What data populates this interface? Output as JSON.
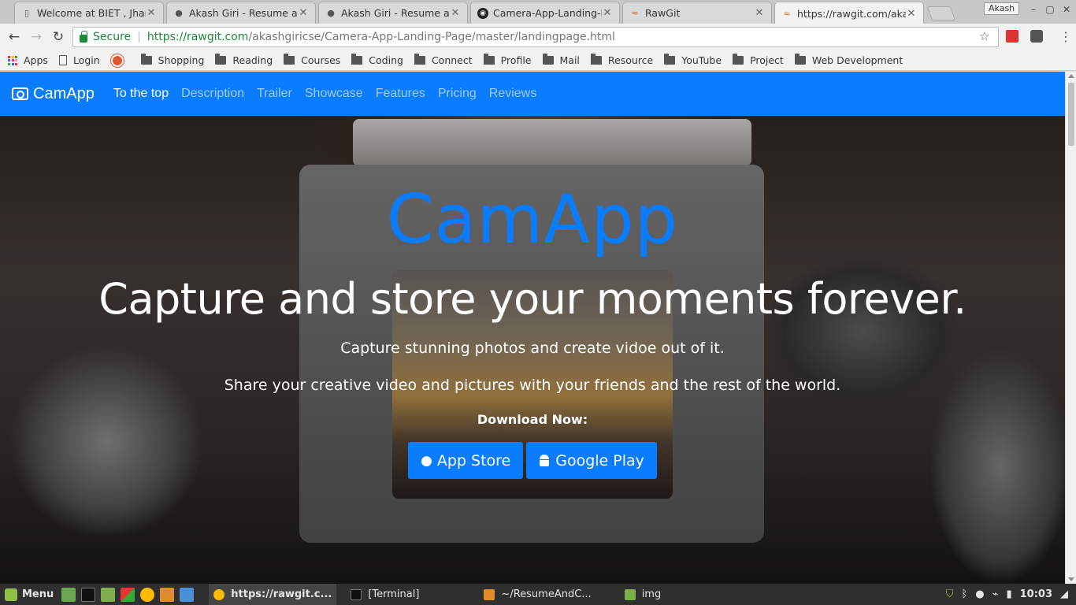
{
  "browser": {
    "tabs": [
      {
        "title": "Welcome at BIET , Jhansi",
        "icon": "page-icon",
        "active": false
      },
      {
        "title": "Akash Giri - Resume and CV",
        "icon": "person-icon",
        "active": false
      },
      {
        "title": "Akash Giri - Resume and CV",
        "icon": "person-icon",
        "active": false
      },
      {
        "title": "Camera-App-Landing-Page",
        "icon": "github-icon",
        "active": false
      },
      {
        "title": "RawGit",
        "icon": "rawgit-icon",
        "active": false
      },
      {
        "title": "https://rawgit.com/akash",
        "icon": "rawgit-icon",
        "active": true
      }
    ],
    "profile_name": "Akash",
    "secure_label": "Secure",
    "url_scheme_host": "https://rawgit.com",
    "url_path": "/akashgiricse/Camera-App-Landing-Page/master/landingpage.html",
    "bookmarks": [
      {
        "label": "Apps",
        "icon": "apps-grid-icon"
      },
      {
        "label": "Login",
        "icon": "page-icon"
      },
      {
        "label": "",
        "icon": "duckduckgo-icon"
      },
      {
        "label": "Shopping",
        "icon": "folder-icon"
      },
      {
        "label": "Reading",
        "icon": "folder-icon"
      },
      {
        "label": "Courses",
        "icon": "folder-icon"
      },
      {
        "label": "Coding",
        "icon": "folder-icon"
      },
      {
        "label": "Connect",
        "icon": "folder-icon"
      },
      {
        "label": "Profile",
        "icon": "folder-icon"
      },
      {
        "label": "Mail",
        "icon": "folder-icon"
      },
      {
        "label": "Resource",
        "icon": "folder-icon"
      },
      {
        "label": "YouTube",
        "icon": "folder-icon"
      },
      {
        "label": "Project",
        "icon": "folder-icon"
      },
      {
        "label": "Web Development",
        "icon": "folder-icon"
      }
    ]
  },
  "site": {
    "brand": "CamApp",
    "nav": [
      "To the top",
      "Description",
      "Trailer",
      "Showcase",
      "Features",
      "Pricing",
      "Reviews"
    ],
    "active_nav": "To the top",
    "hero_title": "CamApp",
    "hero_subtitle": "Capture and store your moments forever.",
    "hero_line1": "Capture stunning photos and create vidoe out of it.",
    "hero_line2": "Share your creative video and pictures with your friends and the rest of the world.",
    "download_label": "Download Now:",
    "app_store_label": "App Store",
    "google_play_label": "Google Play",
    "accent_color": "#0a7cff"
  },
  "taskbar": {
    "menu_label": "Menu",
    "tasks": [
      {
        "label": "https://rawgit.c...",
        "active": true
      },
      {
        "label": "[Terminal]",
        "active": false
      },
      {
        "label": "~/ResumeAndC...",
        "active": false
      },
      {
        "label": "img",
        "active": false
      }
    ],
    "clock": "10:03"
  }
}
